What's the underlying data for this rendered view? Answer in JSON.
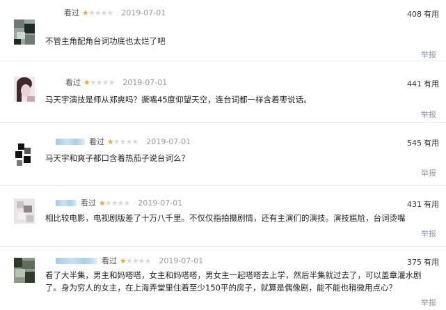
{
  "reviews": [
    {
      "name": "",
      "tag": "看过",
      "rating": 1,
      "date": "2019-07-01",
      "useful_count": "408",
      "useful_label": "有用",
      "content": "不管主角配角台词功底也太烂了吧",
      "report_label": "举报",
      "avatar_colors": [
        "#6f7a73",
        "#1e2a24",
        "#9aa59f",
        "#cfd6d2"
      ]
    },
    {
      "name": "",
      "tag": "看过",
      "rating": 1,
      "date": "2019-07-01",
      "useful_count": "441",
      "useful_label": "有用",
      "content": "马天宇演技是师从郑爽吗？撅嘴45度仰望天空，连台词都一样含着枣说话。",
      "report_label": "举报",
      "avatar_colors": [
        "#f1e5e8",
        "#3a2a2c",
        "#c8a8ae",
        "#ffffff"
      ]
    },
    {
      "name": "",
      "tag": "看过",
      "rating": 1,
      "date": "2019-07-01",
      "useful_count": "545",
      "useful_label": "有用",
      "content": "马天宇和爽子都口含着热茄子说台词么？",
      "report_label": "举报",
      "avatar_colors": [
        "#111111",
        "#ffffff",
        "#555555",
        "#dddddd"
      ]
    },
    {
      "name": "",
      "tag": "看过",
      "rating": 1,
      "date": "2019-07-01",
      "useful_count": "431",
      "useful_label": "有用",
      "content": "相比较电影，电视剧版差了十万八千里。不仅仅指拍摄剧情，还有主演们的演技。演技尴尬，台词烫嘴",
      "report_label": "举报",
      "avatar_colors": [
        "#c9c1c4",
        "#e9e4e6",
        "#8f8589",
        "#f4f1f2"
      ]
    },
    {
      "name": "",
      "tag": "看过",
      "rating": 1,
      "date": "2019-07-01",
      "useful_count": "375",
      "useful_label": "有用",
      "content": "看了大半集，男主和妈嗒嗒，女主和妈嗒嗒，男女主一起嗒嗒去上学，然后半集就过去了，可以盖章灌水剧了。身为穷人的女主，在上海弄堂里住着至少150平的房子，就算是偶像剧，能不能也稍微用点心？",
      "report_label": "举报",
      "avatar_colors": [
        "#5e6e5a",
        "#2e3a2c",
        "#8d9a86",
        "#b8c2b2"
      ]
    }
  ]
}
